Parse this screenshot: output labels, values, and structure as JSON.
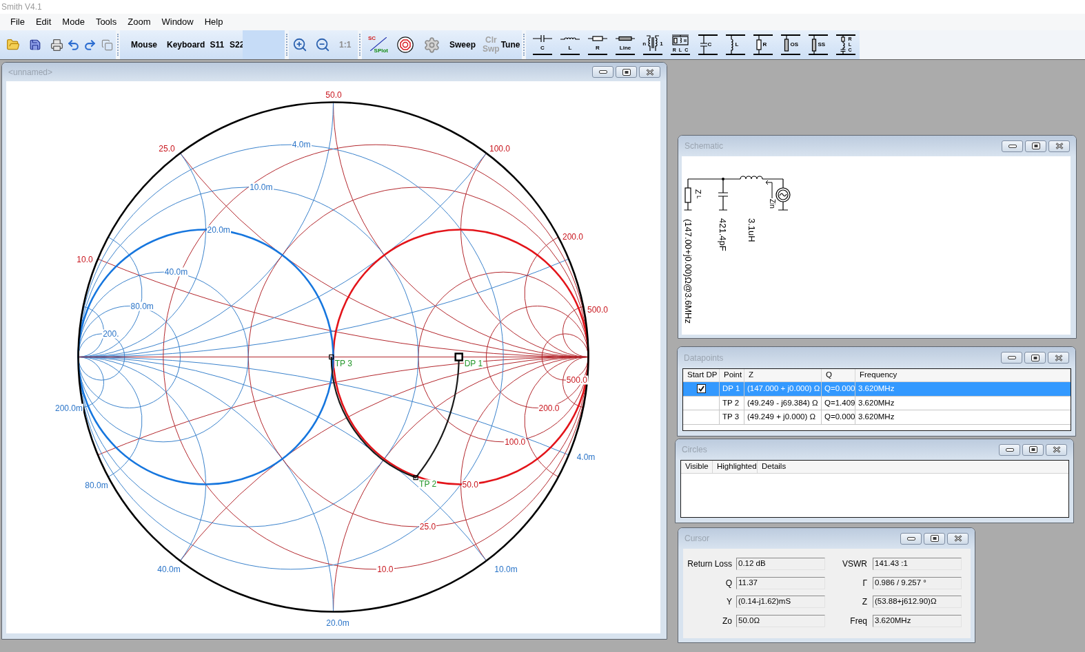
{
  "window": {
    "title": "Smith V4.1"
  },
  "menu": [
    "File",
    "Edit",
    "Mode",
    "Tools",
    "Zoom",
    "Window",
    "Help"
  ],
  "toolbar": {
    "mode_buttons": [
      "Mouse",
      "Keyboard",
      "S11",
      "S22"
    ],
    "zoom_reset": {
      "label": "1:1",
      "disabled": true
    },
    "plot_toggle": {
      "top": "SC",
      "bottom": "SPlot"
    },
    "sweep_buttons": [
      {
        "label": "Sweep",
        "disabled": false
      },
      {
        "label": "Clr Swp",
        "disabled": true
      },
      {
        "label": "Tune",
        "disabled": false
      }
    ],
    "components": [
      {
        "kind": "series_c",
        "labels": [
          "C"
        ]
      },
      {
        "kind": "series_l",
        "labels": [
          "L"
        ]
      },
      {
        "kind": "series_r",
        "labels": [
          "R"
        ]
      },
      {
        "kind": "series_line",
        "labels": [
          "Line"
        ]
      },
      {
        "kind": "transformer",
        "labels": [
          "n",
          "1"
        ]
      },
      {
        "kind": "parallel_rlc",
        "labels": [
          "R",
          "L",
          "C"
        ]
      },
      {
        "kind": "shunt_c",
        "labels": [
          "C"
        ]
      },
      {
        "kind": "shunt_l",
        "labels": [
          "L"
        ]
      },
      {
        "kind": "shunt_r",
        "labels": [
          "R"
        ]
      },
      {
        "kind": "shunt_os",
        "labels": [
          "OS"
        ]
      },
      {
        "kind": "shunt_ss",
        "labels": [
          "SS"
        ]
      },
      {
        "kind": "shunt_rlc",
        "labels": [
          "R",
          "L",
          "C"
        ]
      }
    ]
  },
  "chart_window": {
    "title": "<unnamed>",
    "smith_chart": {
      "reactance_labels": [
        "10.0",
        "25.0",
        "50.0",
        "100.0",
        "200.0",
        "500.0"
      ],
      "resistance_labels": [
        "10.0",
        "25.0",
        "50.0",
        "100.0",
        "200.0",
        "500.0"
      ],
      "conductance_labels": [
        "4.0m",
        "10.0m",
        "20.0m",
        "40.0m",
        "80.0m",
        "200."
      ],
      "susceptance_labels": [
        "4.0m",
        "10.0m",
        "20.0m",
        "40.0m",
        "80.0m",
        "200.0m"
      ],
      "points": [
        {
          "label": "DP 1",
          "kind": "start"
        },
        {
          "label": "TP 2",
          "kind": "turn"
        },
        {
          "label": "TP 3",
          "kind": "turn"
        }
      ]
    }
  },
  "schematic": {
    "title": "Schematic",
    "elements": [
      {
        "kind": "load",
        "label": "Z$_{L}$",
        "value": "(147.00+j0.00)Ω@3.6MHz"
      },
      {
        "kind": "capacitor",
        "value": "421.4pF"
      },
      {
        "kind": "inductor",
        "value": "3.1uH"
      },
      {
        "kind": "source",
        "label": "Zin"
      }
    ]
  },
  "datapoints": {
    "title": "Datapoints",
    "columns": [
      "Start DP",
      "Point",
      "Z",
      "Q",
      "Frequency"
    ],
    "rows": [
      {
        "selected": true,
        "start_dp": true,
        "point": "DP 1",
        "z": "(147.000 + j0.000) Ω",
        "q": "Q=0.000",
        "frequency": "3.620MHz"
      },
      {
        "selected": false,
        "start_dp": false,
        "point": "TP 2",
        "z": "(49.249 - j69.384) Ω",
        "q": "Q=1.409",
        "frequency": "3.620MHz"
      },
      {
        "selected": false,
        "start_dp": false,
        "point": "TP 3",
        "z": "(49.249 + j0.000) Ω",
        "q": "Q=0.000",
        "frequency": "3.620MHz"
      }
    ]
  },
  "circles": {
    "title": "Circles",
    "columns": [
      "Visible",
      "Highlighted",
      "Details"
    ]
  },
  "cursor": {
    "title": "Cursor",
    "fields": [
      {
        "label": "Return Loss",
        "value": "0.12 dB"
      },
      {
        "label": "VSWR",
        "value": "141.43 :1"
      },
      {
        "label": "Q",
        "value": "11.37"
      },
      {
        "label": "Γ",
        "value": "0.986 / 9.257 °"
      },
      {
        "label": "Y",
        "value": "(0.14-j1.62)mS"
      },
      {
        "label": "Z",
        "value": "(53.88+j612.90)Ω"
      },
      {
        "label": "Zo",
        "value": "50.0Ω"
      },
      {
        "label": "Freq",
        "value": "3.620MHz"
      }
    ]
  }
}
